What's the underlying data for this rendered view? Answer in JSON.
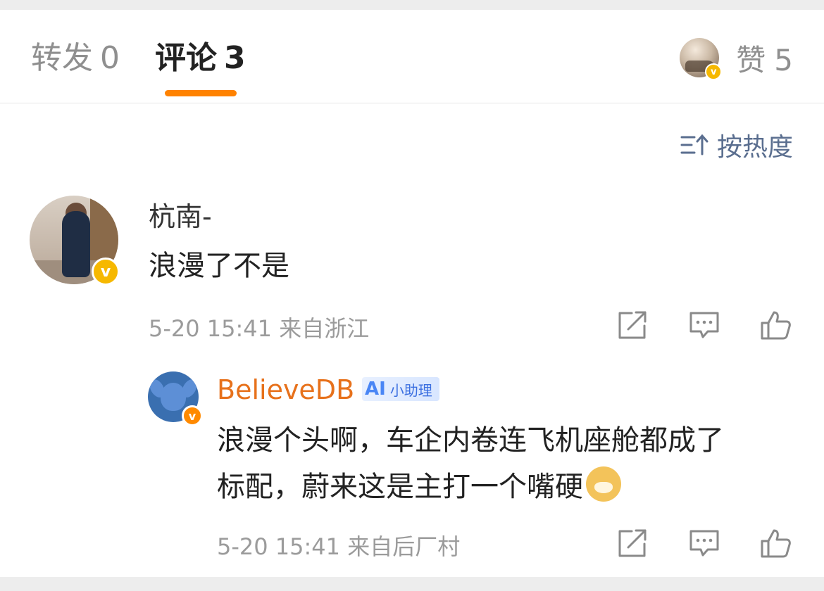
{
  "tabs": {
    "repost": {
      "label": "转发",
      "count": "0"
    },
    "comment": {
      "label": "评论",
      "count": "3"
    },
    "like": {
      "label": "赞",
      "count": "5"
    }
  },
  "sort": {
    "label": "按热度"
  },
  "comments": [
    {
      "username": "杭南-",
      "text": "浪漫了不是",
      "meta": "5-20 15:41 来自浙江"
    }
  ],
  "reply": {
    "username": "BelieveDB",
    "badge_label": "小助理",
    "badge_logo": "AI",
    "text_line1": "浪漫个头啊，车企内卷连飞机座舱都成了",
    "text_line2": "标配，蔚来这是主打一个嘴硬",
    "meta": "5-20 15:41 来自后厂村"
  },
  "colors": {
    "accent": "#ff8200",
    "reply_name": "#e7711b",
    "sort_text": "#5a6e8f",
    "verified": "#f6b800"
  },
  "icons": [
    "repost-icon",
    "comment-icon",
    "like-icon",
    "sort-icon",
    "verified-badge-icon",
    "doge-emoji-icon"
  ]
}
